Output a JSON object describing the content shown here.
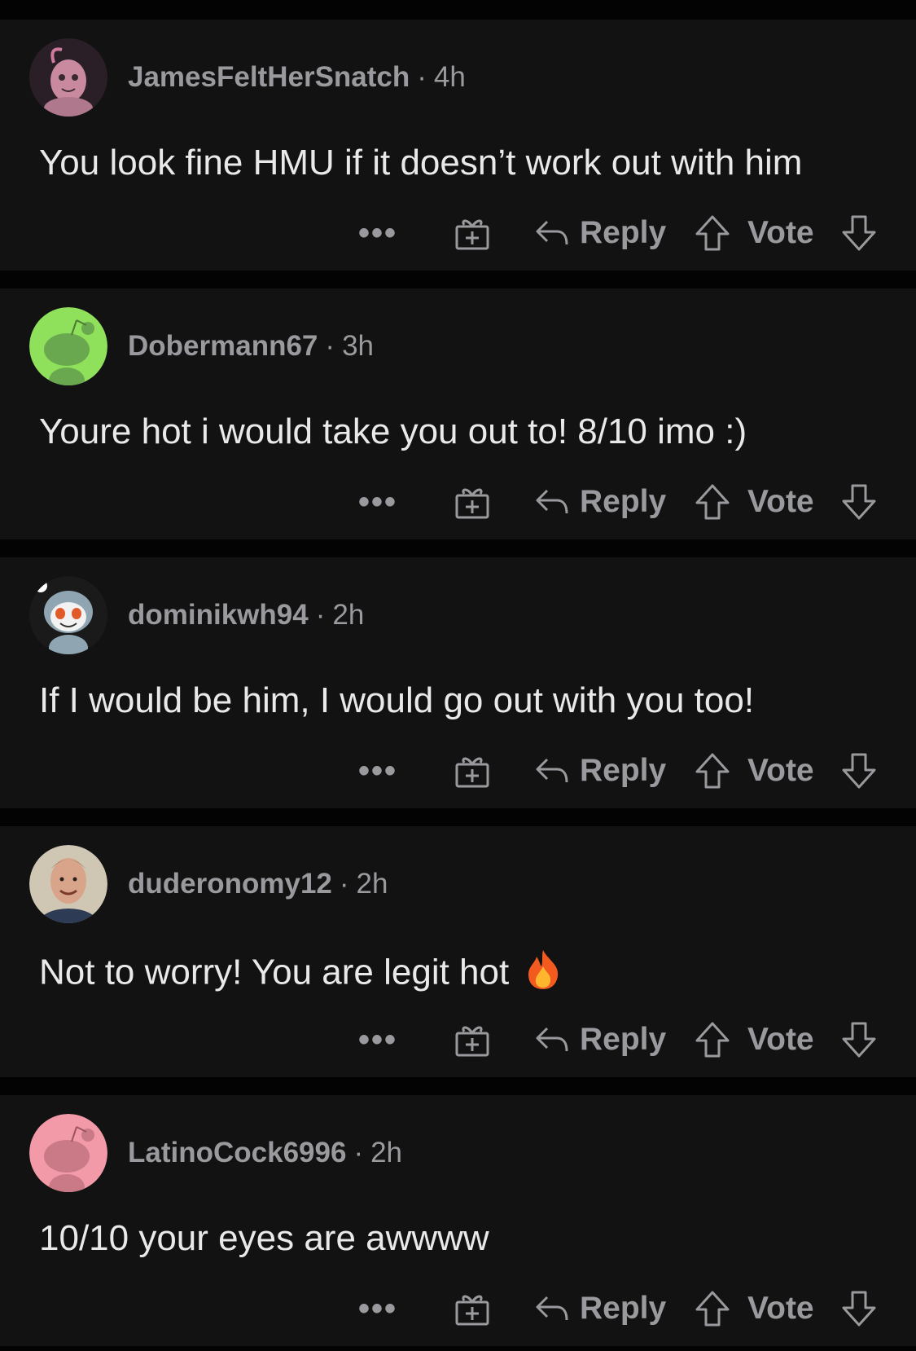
{
  "colors": {
    "background": "#030303",
    "card": "#121212",
    "meta_text": "#9a9a9e",
    "body_text": "#e9e9ea"
  },
  "actions": {
    "more_label": "•••",
    "reply_label": "Reply",
    "vote_label": "Vote"
  },
  "comments": [
    {
      "username": "JamesFeltHerSnatch",
      "age": "4h",
      "body": "You look fine HMU if it doesn’t work out with him",
      "avatar": "snoo-pink-creature",
      "avatar_bg": "#2a1f26"
    },
    {
      "username": "Dobermann67",
      "age": "3h",
      "body": "Youre hot i would take you out to! 8/10 imo :)",
      "avatar": "default-snoo",
      "avatar_bg": "#8fe05a"
    },
    {
      "username": "dominikwh94",
      "age": "2h",
      "body": "If I would be him, I would go out with you too!",
      "avatar": "snoo-custom",
      "avatar_bg": "#1a1a1a"
    },
    {
      "username": "duderonomy12",
      "age": "2h",
      "body": "Not to worry! You are legit hot",
      "body_emoji": "fire",
      "avatar": "photo",
      "avatar_bg": "#cfc6b4"
    },
    {
      "username": "LatinoCock6996",
      "age": "2h",
      "body": "10/10 your eyes are awwww",
      "avatar": "default-snoo",
      "avatar_bg": "#f29aa8"
    }
  ]
}
